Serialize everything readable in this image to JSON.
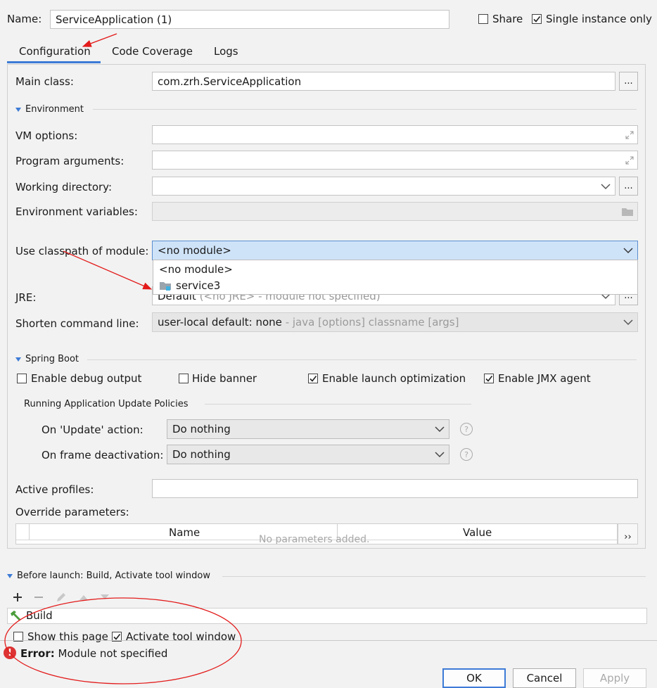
{
  "header": {
    "name_label": "Name:",
    "name_value": "ServiceApplication (1)",
    "share_label": "Share",
    "share_checked": false,
    "single_instance_label": "Single instance only",
    "single_instance_checked": true
  },
  "tabs": [
    {
      "label": "Configuration",
      "active": true
    },
    {
      "label": "Code Coverage",
      "active": false
    },
    {
      "label": "Logs",
      "active": false
    }
  ],
  "config": {
    "main_class_label": "Main class:",
    "main_class_value": "com.zrh.ServiceApplication",
    "browse_label": "...",
    "environment_section": "Environment",
    "vm_options_label": "VM options:",
    "program_arguments_label": "Program arguments:",
    "working_directory_label": "Working directory:",
    "environment_variables_label": "Environment variables:",
    "classpath_label": "Use classpath of module:",
    "classpath_value": "<no module>",
    "classpath_options": [
      "<no module>",
      "service3"
    ],
    "jre_label": "JRE:",
    "jre_value": "Default",
    "jre_hint": "(<no JRE> - module not specified)",
    "shorten_label": "Shorten command line:",
    "shorten_value": "user-local default: none",
    "shorten_hint": "- java [options] classname [args]"
  },
  "spring_boot": {
    "section_label": "Spring Boot",
    "debug_output_label": "Enable debug output",
    "debug_output_checked": false,
    "hide_banner_label": "Hide banner",
    "hide_banner_checked": false,
    "launch_optimization_label": "Enable launch optimization",
    "launch_optimization_checked": true,
    "jmx_agent_label": "Enable JMX agent",
    "jmx_agent_checked": true,
    "policies_section": "Running Application Update Policies",
    "on_update_label": "On 'Update' action:",
    "on_update_value": "Do nothing",
    "on_frame_label": "On frame deactivation:",
    "on_frame_value": "Do nothing",
    "help_label": "?",
    "active_profiles_label": "Active profiles:",
    "override_label": "Override parameters:",
    "table_columns": [
      "Name",
      "Value"
    ],
    "table_empty": "No parameters added.",
    "table_expand_label": "››"
  },
  "before_launch": {
    "section_label": "Before launch: Build, Activate tool window",
    "tasks": [
      "Build"
    ],
    "show_page_label": "Show this page",
    "show_page_checked": false,
    "activate_tool_label": "Activate tool window",
    "activate_tool_checked": true
  },
  "error": {
    "prefix": "Error:",
    "message": "Module not specified"
  },
  "footer": {
    "ok_label": "OK",
    "cancel_label": "Cancel",
    "apply_label": "Apply"
  },
  "colors": {
    "accent": "#3d7bd6",
    "selection": "#cfe3f8",
    "annotation_red": "#e31b1b",
    "error_red": "#dd3333"
  }
}
